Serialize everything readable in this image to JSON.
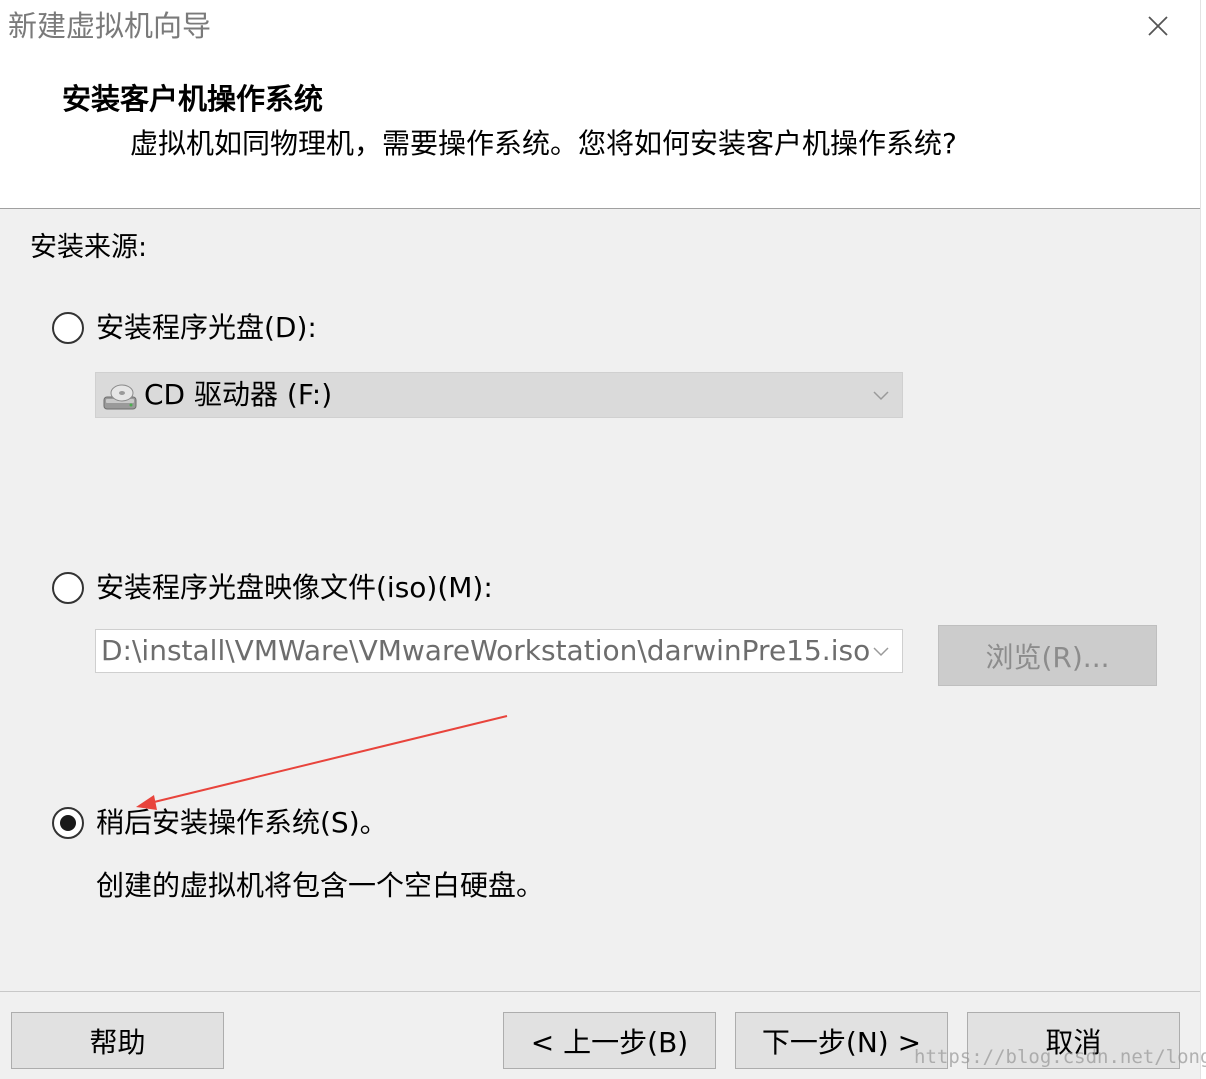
{
  "window": {
    "title": "新建虚拟机向导"
  },
  "header": {
    "title": "安装客户机操作系统",
    "subtitle": "虚拟机如同物理机，需要操作系统。您将如何安装客户机操作系统?"
  },
  "install_source": {
    "label": "安装来源:",
    "options": [
      {
        "label": "安装程序光盘(D):",
        "selected": false
      },
      {
        "label": "安装程序光盘映像文件(iso)(M):",
        "selected": false
      },
      {
        "label": "稍后安装操作系统(S)。",
        "selected": true
      }
    ],
    "cd_drive": {
      "value": "CD 驱动器 (F:)",
      "icon": "cd-drive-icon"
    },
    "iso_path": {
      "value": "D:\\install\\VMWare\\VMwareWorkstation\\darwinPre15.iso"
    },
    "browse_label": "浏览(R)...",
    "later_description": "创建的虚拟机将包含一个空白硬盘。"
  },
  "footer": {
    "help_label": "帮助",
    "back_label": "< 上一步(B)",
    "next_label": "下一步(N) >",
    "cancel_label": "取消"
  },
  "watermark": "https://blog.csdn.net/longji",
  "colors": {
    "annotation_arrow": "#e8443c",
    "dialog_background": "#f0f0f0",
    "header_background": "#ffffff"
  }
}
